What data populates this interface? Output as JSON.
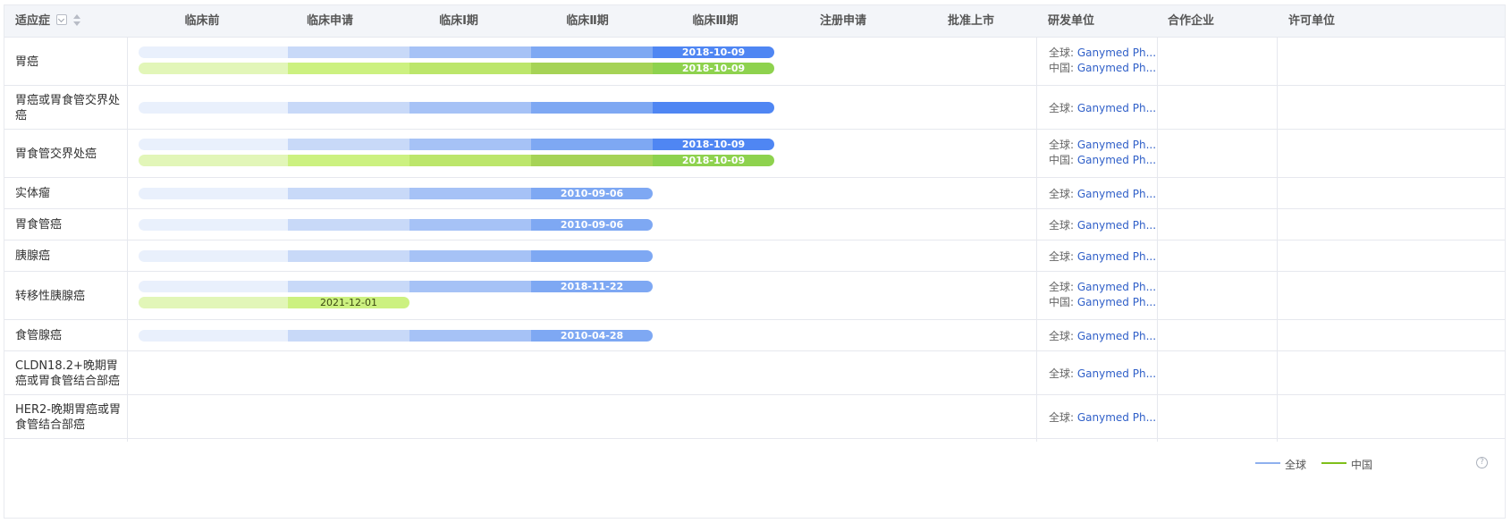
{
  "header": {
    "indication": "适应症",
    "stages": [
      "临床前",
      "临床申请",
      "临床Ⅰ期",
      "临床Ⅱ期",
      "临床Ⅲ期",
      "注册申请",
      "批准上市"
    ],
    "developer": "研发单位",
    "partner": "合作企业",
    "licensor": "许可单位"
  },
  "colors": {
    "global_segments": [
      "#e9f0fc",
      "#c8d9f8",
      "#a6c2f6",
      "#7ea8f3",
      "#4f86f3"
    ],
    "china_segments": [
      "#e2f6b8",
      "#ccf180",
      "#bce66b",
      "#a6d356",
      "#8ed24e"
    ],
    "global_legend": "#8fb0ee",
    "china_legend": "#7fbf1a"
  },
  "developer_prefix": {
    "global": "全球:",
    "china": "中国:"
  },
  "rows": [
    {
      "indication": "胃癌",
      "bars": [
        {
          "region": "global",
          "stage_reached": 5,
          "date": "2018-10-09"
        },
        {
          "region": "china",
          "stage_reached": 5,
          "date": "2018-10-09"
        }
      ],
      "developers": [
        {
          "region": "global",
          "name": "Ganymed Ph..."
        },
        {
          "region": "china",
          "name": "Ganymed Ph..."
        }
      ]
    },
    {
      "indication": "胃癌或胃食管交界处癌",
      "bars": [
        {
          "region": "global",
          "stage_reached": 5,
          "date": ""
        }
      ],
      "developers": [
        {
          "region": "global",
          "name": "Ganymed Ph..."
        }
      ]
    },
    {
      "indication": "胃食管交界处癌",
      "bars": [
        {
          "region": "global",
          "stage_reached": 5,
          "date": "2018-10-09"
        },
        {
          "region": "china",
          "stage_reached": 5,
          "date": "2018-10-09"
        }
      ],
      "developers": [
        {
          "region": "global",
          "name": "Ganymed Ph..."
        },
        {
          "region": "china",
          "name": "Ganymed Ph..."
        }
      ]
    },
    {
      "indication": "实体瘤",
      "bars": [
        {
          "region": "global",
          "stage_reached": 4,
          "date": "2010-09-06"
        }
      ],
      "developers": [
        {
          "region": "global",
          "name": "Ganymed Ph..."
        }
      ]
    },
    {
      "indication": "胃食管癌",
      "bars": [
        {
          "region": "global",
          "stage_reached": 4,
          "date": "2010-09-06"
        }
      ],
      "developers": [
        {
          "region": "global",
          "name": "Ganymed Ph..."
        }
      ]
    },
    {
      "indication": "胰腺癌",
      "bars": [
        {
          "region": "global",
          "stage_reached": 4,
          "date": ""
        }
      ],
      "developers": [
        {
          "region": "global",
          "name": "Ganymed Ph..."
        }
      ]
    },
    {
      "indication": "转移性胰腺癌",
      "bars": [
        {
          "region": "global",
          "stage_reached": 4,
          "date": "2018-11-22"
        },
        {
          "region": "china",
          "stage_reached": 2,
          "date": "2021-12-01"
        }
      ],
      "developers": [
        {
          "region": "global",
          "name": "Ganymed Ph..."
        },
        {
          "region": "china",
          "name": "Ganymed Ph..."
        }
      ]
    },
    {
      "indication": "食管腺癌",
      "bars": [
        {
          "region": "global",
          "stage_reached": 4,
          "date": "2010-04-28"
        }
      ],
      "developers": [
        {
          "region": "global",
          "name": "Ganymed Ph..."
        }
      ]
    },
    {
      "indication": "CLDN18.2+晚期胃癌或胃食管结合部癌",
      "bars": [],
      "developers": [
        {
          "region": "global",
          "name": "Ganymed Ph..."
        }
      ]
    },
    {
      "indication": "HER2-晚期胃癌或胃食管结合部癌",
      "bars": [],
      "developers": [
        {
          "region": "global",
          "name": "Ganymed Ph..."
        }
      ]
    }
  ],
  "legend": {
    "global": "全球",
    "china": "中国"
  }
}
